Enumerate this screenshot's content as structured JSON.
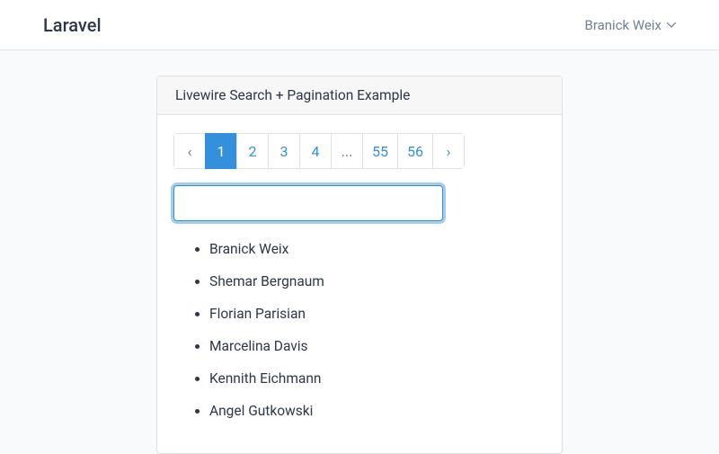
{
  "navbar": {
    "brand": "Laravel",
    "user_name": "Branick Weix"
  },
  "card": {
    "title": "Livewire Search + Pagination Example"
  },
  "pagination": {
    "prev": "‹",
    "next": "›",
    "pages": [
      "1",
      "2",
      "3",
      "4",
      "...",
      "55",
      "56"
    ],
    "active_index": 0
  },
  "search": {
    "value": "",
    "placeholder": ""
  },
  "results": [
    "Branick Weix",
    "Shemar Bergnaum",
    "Florian Parisian",
    "Marcelina Davis",
    "Kennith Eichmann",
    "Angel Gutkowski"
  ]
}
